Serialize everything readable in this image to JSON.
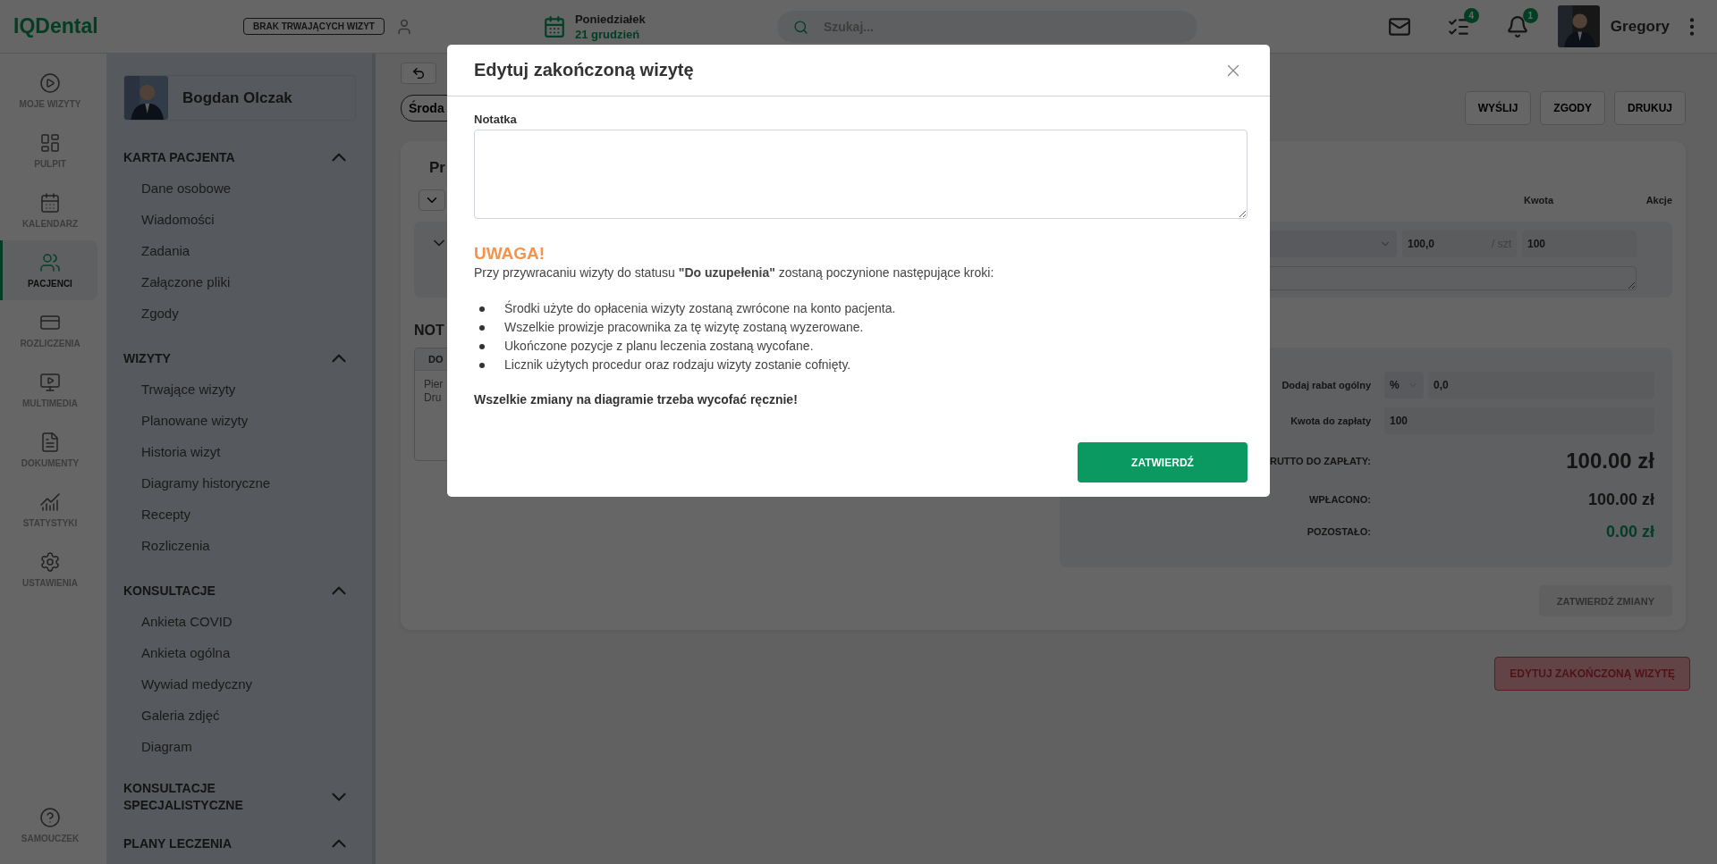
{
  "topbar": {
    "logo": "IQDental",
    "visit_status": "BRAK TRWAJĄCYCH WIZYT",
    "day": "Poniedziałek",
    "date": "21 grudzień",
    "search": {
      "placeholder": "Szukaj..."
    },
    "task_count": "4",
    "notification_count": "1",
    "user_name": "Gregory"
  },
  "nav": {
    "items": [
      {
        "label": "MOJE WIZYTY",
        "selected": false
      },
      {
        "label": "PULPIT",
        "selected": false
      },
      {
        "label": "KALENDARZ",
        "selected": false
      },
      {
        "label": "PACJENCI",
        "selected": true
      },
      {
        "label": "ROZLICZENIA",
        "selected": false
      },
      {
        "label": "MULTIMEDIA",
        "selected": false
      },
      {
        "label": "DOKUMENTY",
        "selected": false
      },
      {
        "label": "STATYSTYKI",
        "selected": false
      },
      {
        "label": "USTAWIENIA",
        "selected": false
      }
    ],
    "help": "SAMOUCZEK"
  },
  "patient": {
    "name": "Bogdan Olczak",
    "sections": [
      {
        "title": "KARTA PACJENTA",
        "expanded": true,
        "items": [
          "Dane osobowe",
          "Wiadomości",
          "Zadania",
          "Załączone pliki",
          "Zgody"
        ]
      },
      {
        "title": "WIZYTY",
        "expanded": true,
        "items": [
          "Trwające wizyty",
          "Planowane wizyty",
          "Historia wizyt",
          "Diagramy historyczne",
          "Recepty",
          "Rozliczenia"
        ]
      },
      {
        "title": "KONSULTACJE",
        "expanded": true,
        "items": [
          "Ankieta COVID",
          "Ankieta ogólna",
          "Wywiad medyczny",
          "Galeria zdjęć",
          "Diagram"
        ]
      },
      {
        "title": "KONSULTACJE SPECJALISTYCZNE",
        "expanded": false
      },
      {
        "title": "PLANY LECZENIA",
        "expanded": true
      }
    ]
  },
  "visit": {
    "date_pill": "Środa",
    "actions": [
      "WYŚLIJ",
      "ZGODY",
      "DRUKUJ"
    ],
    "panel_title": "Pr",
    "columns": [
      "Kwota",
      "Akcje"
    ],
    "item": {
      "unit_price": "100,0",
      "unit": "/ szt",
      "amount": "100"
    },
    "notes_title": "NOT",
    "notes_header": "DO",
    "notes_lines": [
      "Pier",
      "Dru"
    ],
    "summary": {
      "discount_label": "Dodaj rabat ogólny",
      "discount_type": "%",
      "discount_value": "0,0",
      "due_label": "Kwota do zapłaty",
      "due_value": "100",
      "totals": [
        {
          "label": "RUTTO DO ZAPŁATY:",
          "value": "100.00 zł",
          "kind": "total"
        },
        {
          "label": "WPŁACONO:",
          "value": "100.00 zł",
          "kind": "paid"
        },
        {
          "label": "POZOSTAŁO:",
          "value": "0.00 zł",
          "kind": "remaining"
        }
      ]
    },
    "confirm_changes": {
      "label": "ZATWIERDŹ ZMIANY",
      "disabled": true
    },
    "edit_button": "EDYTUJ ZAKOŃCZONĄ WIZYTĘ"
  },
  "modal": {
    "title": "Edytuj zakończoną wizytę",
    "note_label": "Notatka",
    "warning_title": "UWAGA!",
    "warning_intro": "Przy przywracaniu wizyty do statusu **\"Do uzupełenia\"** zostaną poczynione następujące kroki:",
    "steps": [
      "Środki użyte do opłacenia wizyty zostaną zwrócone na konto pacjenta.",
      "Wszelkie prowizje pracownika za tę wizytę zostaną wyzerowane.",
      "Ukończone pozycje z planu leczenia zostaną wycofane.",
      "Licznik użytych procedur oraz rodzaju wizyty zostanie cofnięty."
    ],
    "final_note": "Wszelkie zmiany na diagramie trzeba wycofać ręcznie!",
    "confirm": "ZATWIERDŹ"
  }
}
